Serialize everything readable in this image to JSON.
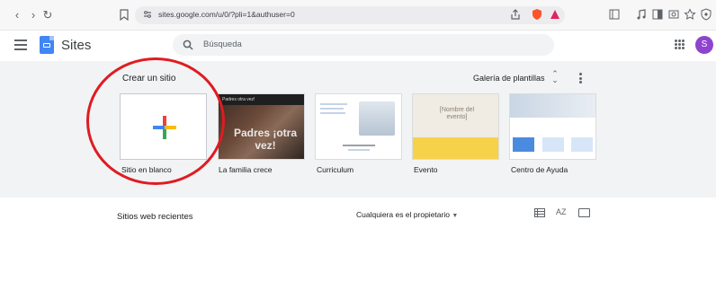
{
  "browser": {
    "url": "sites.google.com/u/0/?pli=1&authuser=0"
  },
  "header": {
    "app_title": "Sites",
    "search_placeholder": "Búsqueda",
    "avatar_initial": "S"
  },
  "gallery": {
    "section_label": "Crear un sitio",
    "toggle_label": "Galería de plantillas",
    "templates": [
      {
        "label": "Sitio en blanco"
      },
      {
        "label": "La familia crece",
        "thumb_header": "Padres otra vez!",
        "thumb_big": "Padres ¡otra vez!"
      },
      {
        "label": "Curriculum"
      },
      {
        "label": "Evento",
        "thumb_text": "[Nombre del evento]"
      },
      {
        "label": "Centro de Ayuda"
      }
    ]
  },
  "recent": {
    "title": "Sitios web recientes",
    "owner_filter": "Cualquiera es el propietario",
    "sort_label": "AZ"
  },
  "colors": {
    "accent_blue": "#4285f4",
    "avatar_purple": "#8e44ce",
    "annotation_red": "#e01b22"
  }
}
